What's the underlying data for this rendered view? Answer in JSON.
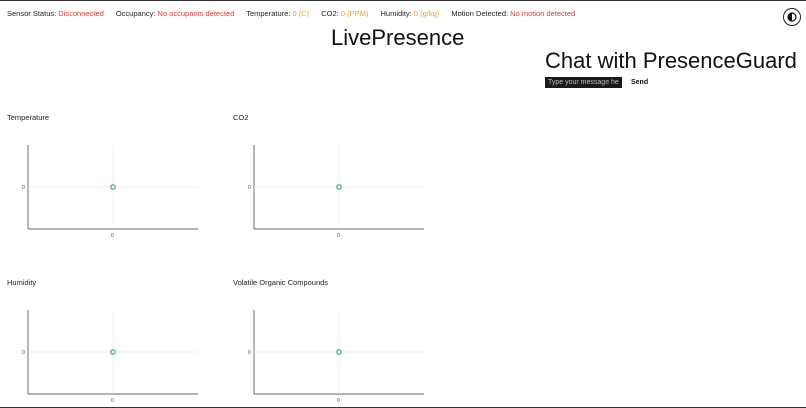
{
  "status_bar": {
    "sensor": {
      "label": "Sensor Status:",
      "value": "Disconnected"
    },
    "occupancy": {
      "label": "Occupancy:",
      "value": "No occupants detected"
    },
    "temperature": {
      "label": "Temperature:",
      "value": "0 (C)"
    },
    "co2": {
      "label": "CO2:",
      "value": "0 (PPM)"
    },
    "humidity": {
      "label": "Humidity:",
      "value": "0 (g/kg)"
    },
    "motion": {
      "label": "Motion Detected:",
      "value": "No motion detected"
    }
  },
  "colors": {
    "alert": "#e53935",
    "reading": "#f0a21a",
    "point": "#26a69a"
  },
  "theme_toggle": {
    "icon": "contrast-icon"
  },
  "app_title": "LivePresence",
  "chat": {
    "title": "Chat with PresenceGuard",
    "input_placeholder": "Type your message here.",
    "input_value": "",
    "send_label": "Send"
  },
  "charts": {
    "temperature": {
      "title": "Temperature",
      "x_tick": "0",
      "y_tick": "0"
    },
    "co2": {
      "title": "CO2",
      "x_tick": "0",
      "y_tick": "0"
    },
    "humidity": {
      "title": "Humidity",
      "x_tick": "0",
      "y_tick": "0"
    },
    "voc": {
      "title": "Volatile Organic Compounds",
      "x_tick": "0",
      "y_tick": "0"
    }
  },
  "chart_data": [
    {
      "type": "scatter",
      "title": "Temperature",
      "x": [
        0
      ],
      "y": [
        0
      ]
    },
    {
      "type": "scatter",
      "title": "CO2",
      "x": [
        0
      ],
      "y": [
        0
      ]
    },
    {
      "type": "scatter",
      "title": "Humidity",
      "x": [
        0
      ],
      "y": [
        0
      ]
    },
    {
      "type": "scatter",
      "title": "Volatile Organic Compounds",
      "x": [
        0
      ],
      "y": [
        0
      ]
    }
  ]
}
